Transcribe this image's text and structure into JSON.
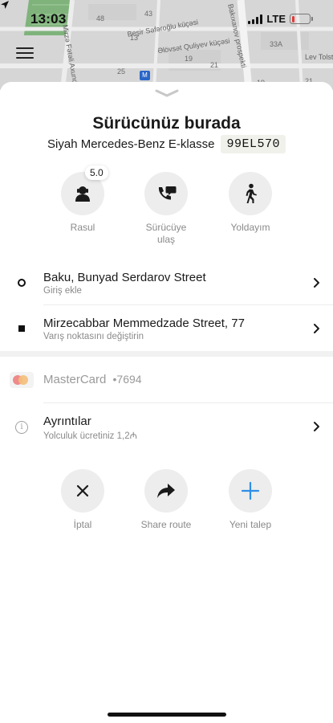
{
  "status_bar": {
    "time": "13:03",
    "network": "LTE"
  },
  "map": {
    "streets": [
      "Beşir Səfəroğlu küçəsi",
      "Əlövsət Quliyev küçəsi",
      "Mirzə Fətəli Axundov",
      "Bakıxanov prospekti",
      "Lev Tolstoy"
    ],
    "house_numbers": [
      "48",
      "43",
      "13",
      "33A",
      "19",
      "21",
      "25",
      "19",
      "21"
    ],
    "metro_label": "M"
  },
  "driver_sheet": {
    "title": "Sürücünüz burada",
    "car_model": "Siyah Mercedes-Benz E-klasse",
    "plate": "99EL570",
    "driver_rating": "5.0",
    "actions_top": [
      {
        "label": "Rasul",
        "icon": "driver-avatar-icon"
      },
      {
        "label": "Sürücüye ulaş",
        "icon": "phone-chat-icon"
      },
      {
        "label": "Yoldayım",
        "icon": "walking-person-icon"
      }
    ]
  },
  "route": {
    "pickup": {
      "address": "Baku, Bunyad Serdarov Street",
      "hint": "Giriş ekle"
    },
    "destination": {
      "address": "Mirzecabbar Memmedzade Street, 77",
      "hint": "Varış noktasını değiştirin"
    }
  },
  "payment": {
    "card_brand": "MasterCard",
    "card_last4": "•7694"
  },
  "details": {
    "title": "Ayrıntılar",
    "subtitle": "Yolculuk ücretiniz 1,2₼"
  },
  "actions_bottom": [
    {
      "label": "İptal",
      "icon": "close-icon"
    },
    {
      "label": "Share route",
      "icon": "share-arrow-icon"
    },
    {
      "label": "Yeni talep",
      "icon": "plus-icon"
    }
  ],
  "colors": {
    "accent_blue": "#2f8fe8",
    "battery_low": "#e53935",
    "sheet_bg": "#ffffff",
    "circle_bg": "#ededed"
  }
}
